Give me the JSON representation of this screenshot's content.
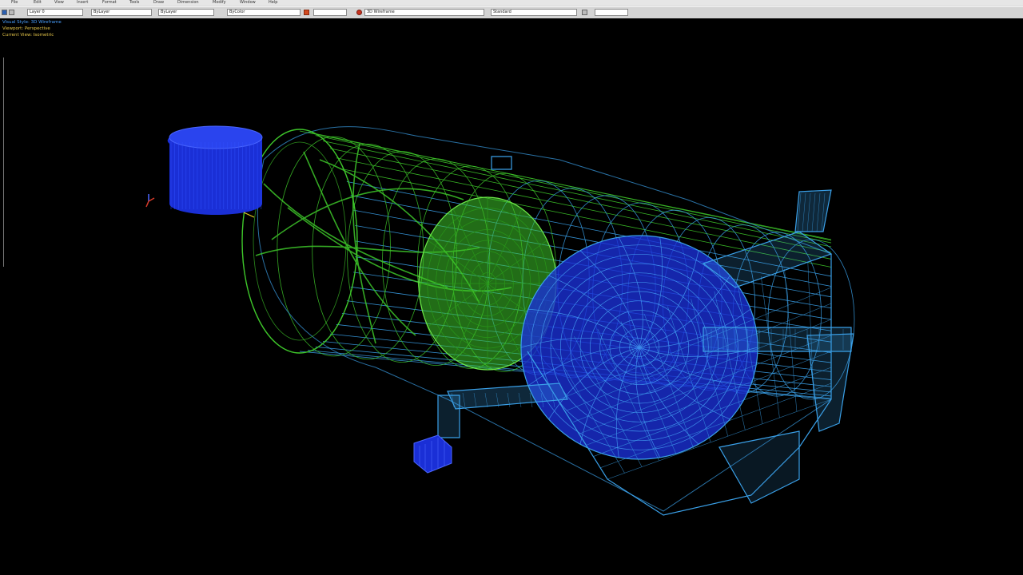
{
  "toolbar": {
    "menu": [
      "File",
      "Edit",
      "View",
      "Insert",
      "Format",
      "Tools",
      "Draw",
      "Dimension",
      "Modify",
      "Window",
      "Help"
    ],
    "fields": [
      "Layer 0",
      "ByLayer",
      "ByLayer",
      "ByColor",
      "3D Wireframe",
      "Standard"
    ],
    "colors": {
      "bg": "#d4d4d4",
      "accent": "#c8321e"
    }
  },
  "viewport": {
    "info_lines": [
      "Visual Style: 3D Wireframe",
      "Viewport: Perspective",
      "Current View: Isometric"
    ],
    "colors": {
      "background": "#000000",
      "green": "#3ec62a",
      "blue": "#1a2fd6",
      "cyan": "#3aa0e8",
      "info_text": "#e8c84a",
      "info_label": "#4aa0ff"
    }
  },
  "model": {
    "parts": [
      "cylinder-tank",
      "blue-drum",
      "end-housing",
      "pipe-arms",
      "small-block",
      "ucs-icon"
    ]
  }
}
